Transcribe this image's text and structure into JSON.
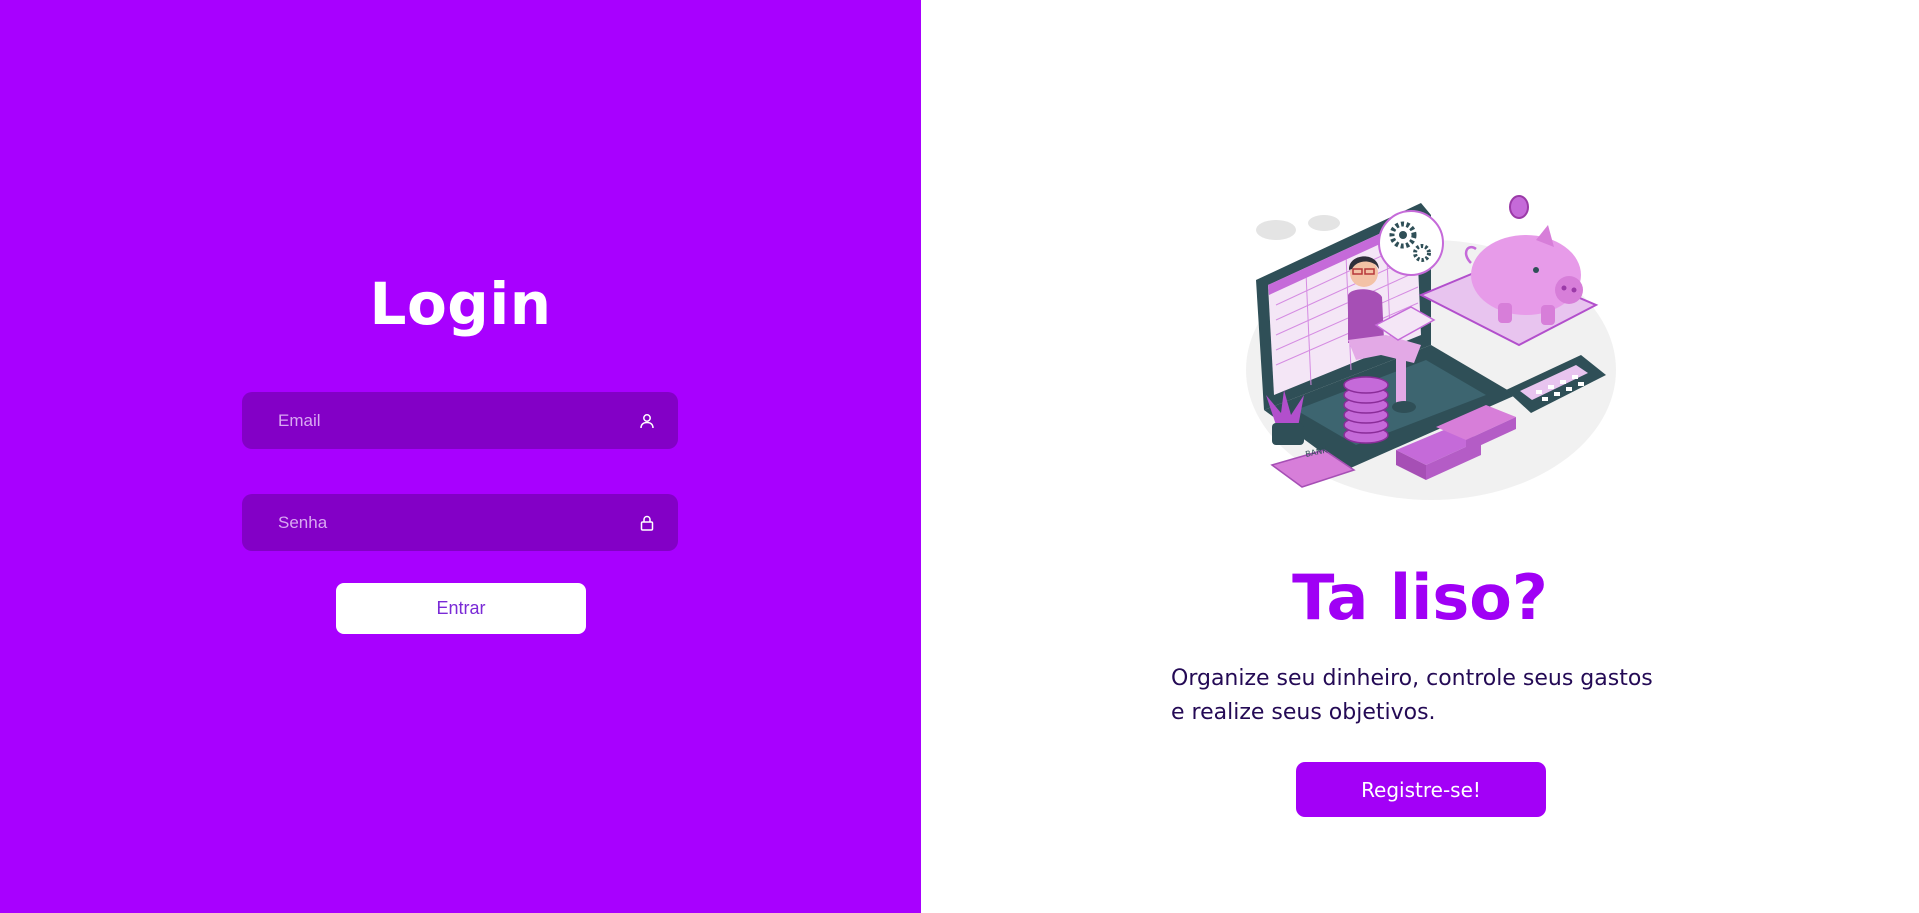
{
  "colors": {
    "left_background": "#a800ff",
    "input_background": "#8300c6",
    "accent": "#a300f7",
    "description_text": "#240a55",
    "entrar_text": "#7a2ad6"
  },
  "login": {
    "title": "Login",
    "email": {
      "value": "",
      "placeholder": "Email",
      "icon": "user-icon"
    },
    "password": {
      "value": "",
      "placeholder": "Senha",
      "icon": "lock-icon"
    },
    "submit_label": "Entrar"
  },
  "promo": {
    "illustration": "finance-illustration",
    "bank_card_text": "BANK",
    "title": "Ta liso?",
    "description_line1": "Organize seu dinheiro, controle seus gastos",
    "description_line2": "e realize seus objetivos.",
    "register_label": "Registre-se!"
  }
}
